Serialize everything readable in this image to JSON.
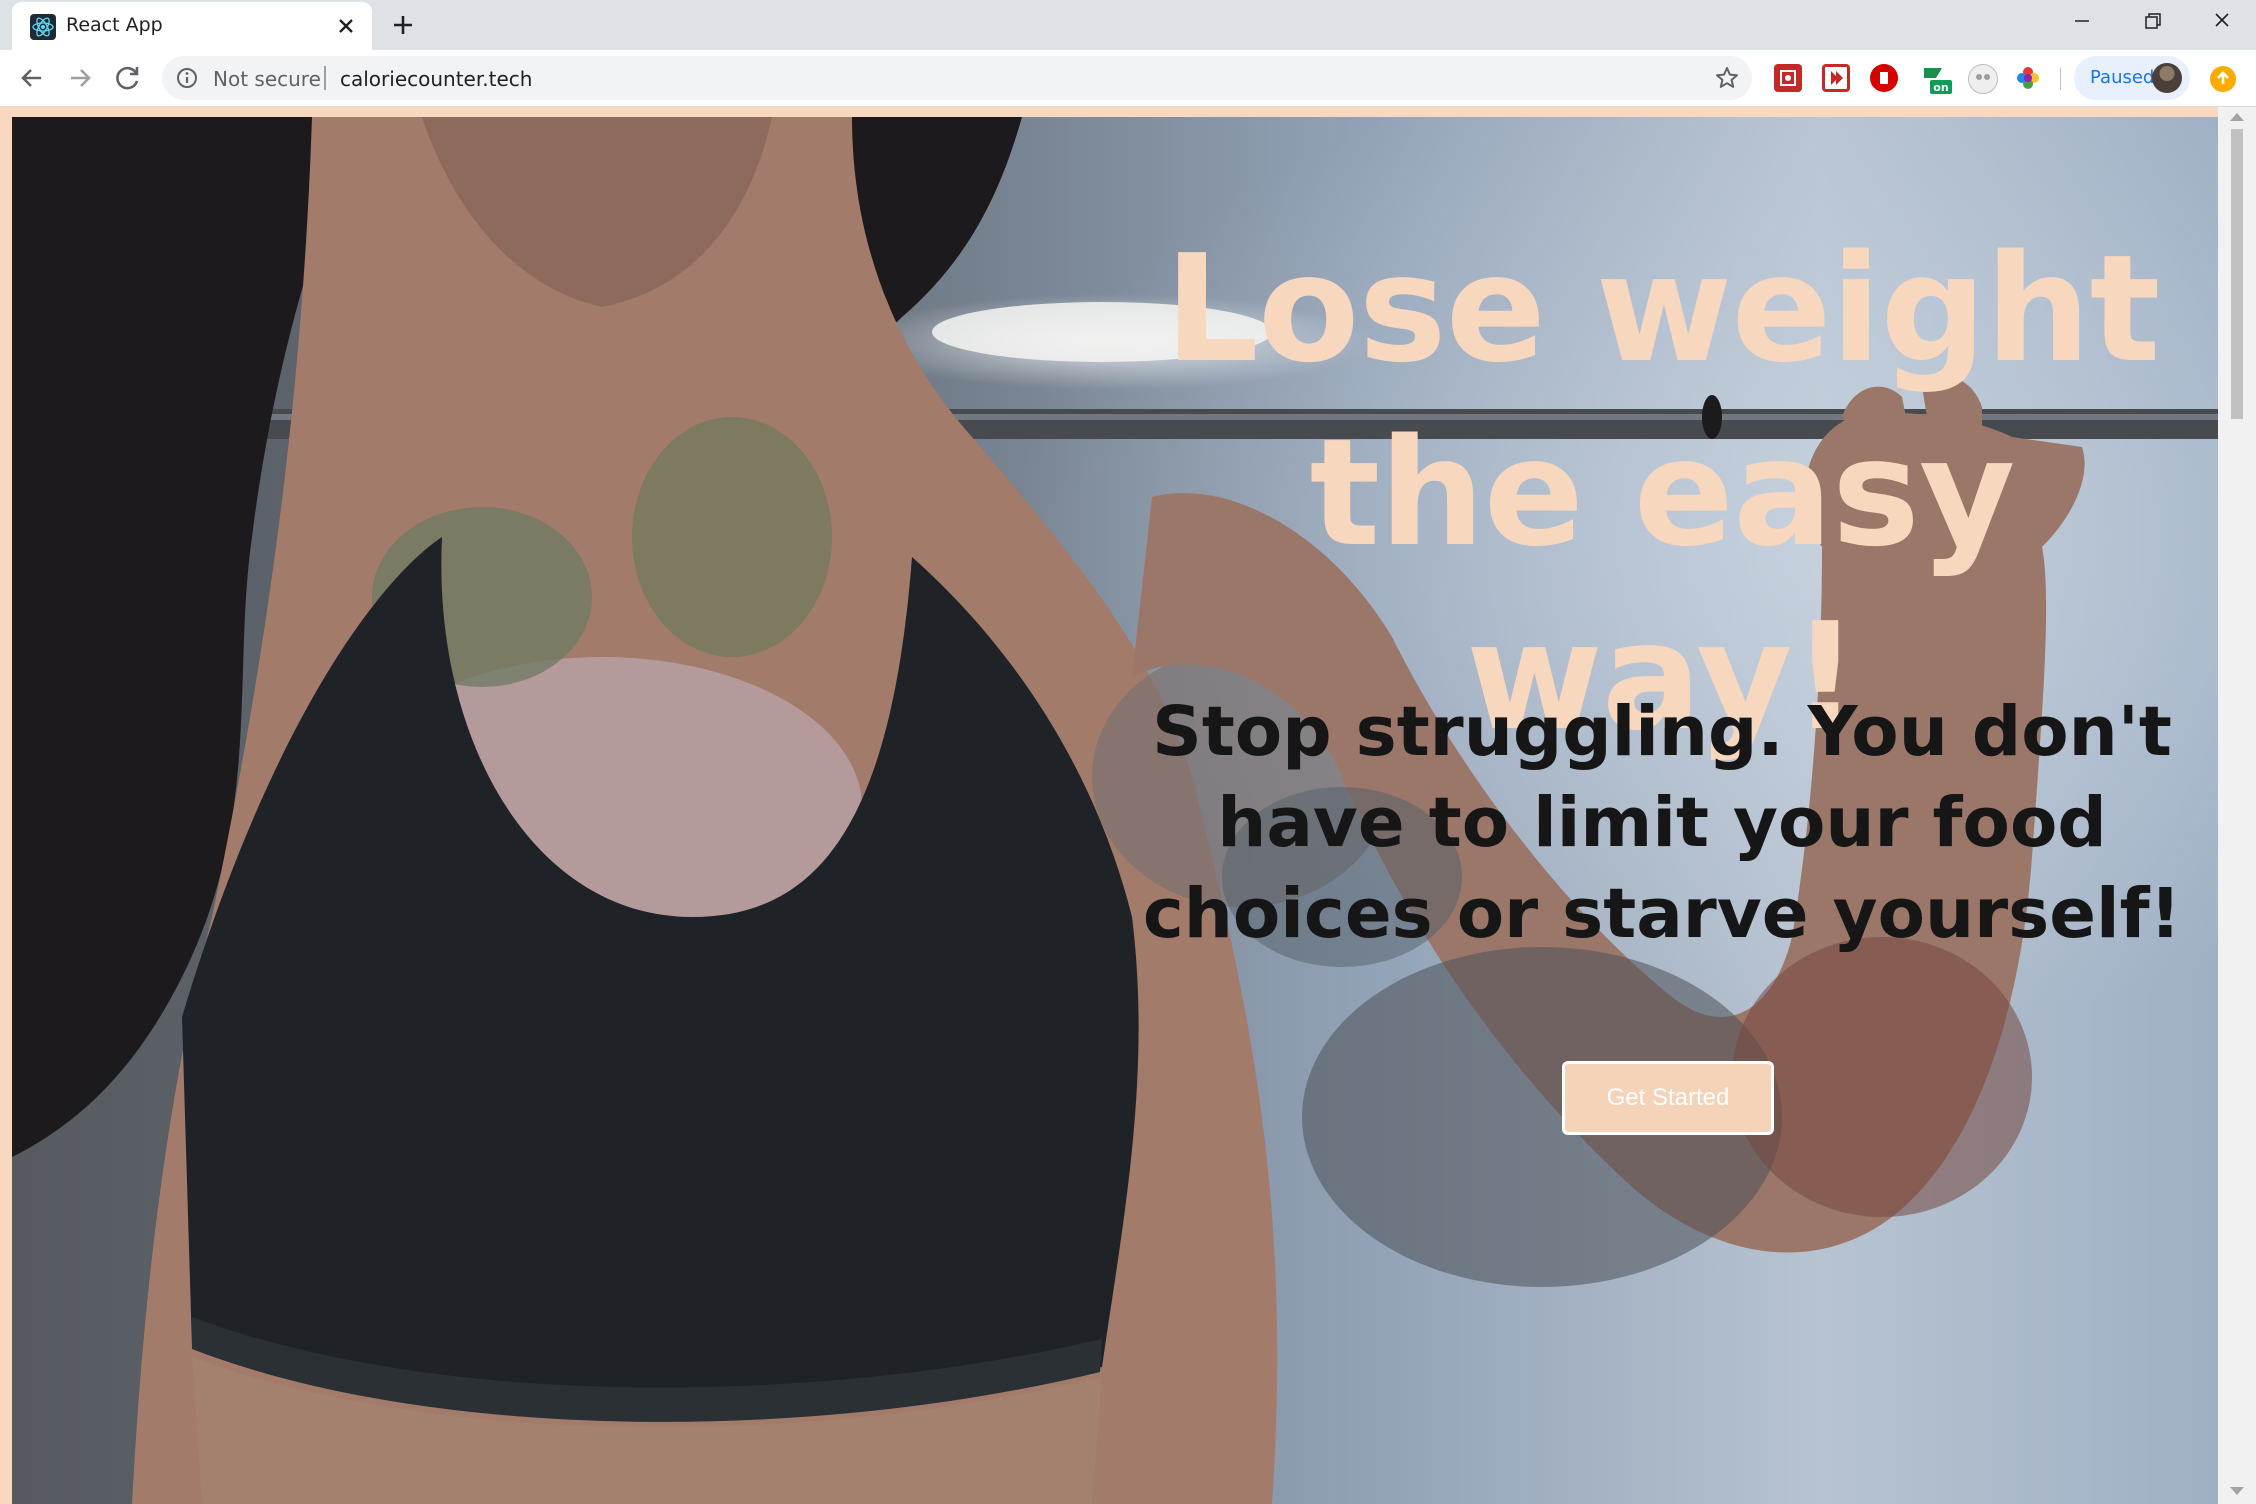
{
  "browser": {
    "tab": {
      "title": "React App"
    },
    "address": {
      "security_label": "Not secure",
      "url": "caloriecounter.tech"
    },
    "profile": {
      "status": "Paused"
    },
    "extensions": [
      "red-puzzle-icon",
      "video-download-icon",
      "adblock-icon",
      "green-on-badge-icon",
      "panda-icon",
      "color-wheel-icon"
    ]
  },
  "hero": {
    "title": "Lose weight the easy way!",
    "subtitle": "Stop struggling. You don't have to limit your food choices or starve yourself!",
    "cta_label": "Get Started",
    "colors": {
      "title": "#f7d7be",
      "subtitle": "#161616",
      "page_border": "#f8d8bf",
      "button": "#f5d3b8"
    }
  }
}
